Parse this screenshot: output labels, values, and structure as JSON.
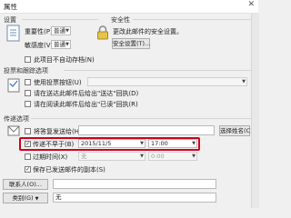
{
  "window": {
    "title": "属性",
    "close_glyph": "✕"
  },
  "settings": {
    "section_title": "设置",
    "importance_label": "重要性(P)",
    "importance_value": "普通",
    "sensitivity_label": "敏感度(V)",
    "sensitivity_value": "普通",
    "no_autoarchive_label": "此项目不自动存档(N)"
  },
  "security": {
    "section_title": "安全性",
    "description": "更改此邮件的安全设置。",
    "settings_button": "安全设置(T)..."
  },
  "voting": {
    "section_title": "投票和跟踪选项",
    "use_voting_buttons_label": "使用投票按钮(U)",
    "delivery_receipt_label": "请在送达此邮件后给出\"送达\"回执(D)",
    "read_receipt_label": "请在阅读此邮件后给出\"已读\"回执(R)"
  },
  "delivery": {
    "section_title": "传递选项",
    "have_replies_sent_to_label": "将答复发送给(H)",
    "select_names_button": "选择姓名(C)...",
    "do_not_deliver_before_label": "传递不早于(B)",
    "do_not_deliver_before_checked": true,
    "date_value": "2015/11/5",
    "time_value": "17:00",
    "expires_after_label": "过期时间(X)",
    "expires_date_value": "无",
    "expires_time_value": "0:00",
    "save_copy_label": "保存已发送邮件的副本(S)",
    "save_copy_checked": true
  },
  "footer": {
    "contacts_button": "联系人(O)...",
    "categories_button": "类别(G)",
    "categories_value": "无"
  },
  "colors": {
    "highlight": "#d0021b"
  }
}
